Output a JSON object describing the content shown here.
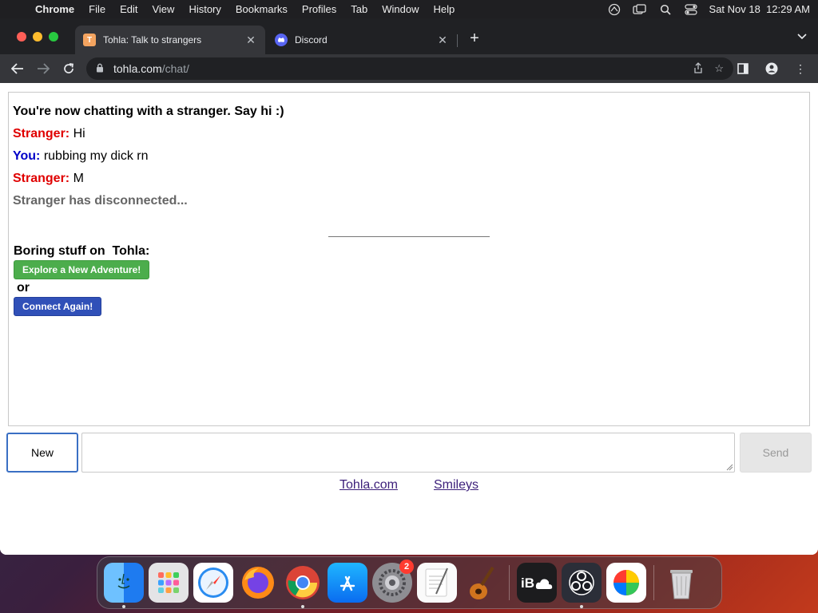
{
  "menubar": {
    "app": "Chrome",
    "items": [
      "File",
      "Edit",
      "View",
      "History",
      "Bookmarks",
      "Profiles",
      "Tab",
      "Window",
      "Help"
    ],
    "datetime": "Sat Nov 18  12:29 AM"
  },
  "browser": {
    "tabs": [
      {
        "title": "Tohla: Talk to strangers",
        "favicon": "T",
        "active": true
      },
      {
        "title": "Discord",
        "favicon": "discord-icon",
        "active": false
      }
    ],
    "url_host": "tohla.com",
    "url_path": "/chat/"
  },
  "chat": {
    "intro": "You're now chatting with a stranger. Say hi :)",
    "messages": [
      {
        "speaker": "Stranger:",
        "text": "Hi",
        "type": "stranger"
      },
      {
        "speaker": "You:",
        "text": "rubbing my dick rn",
        "type": "you"
      },
      {
        "speaker": "Stranger:",
        "text": "M",
        "type": "stranger"
      }
    ],
    "status": "Stranger has disconnected...",
    "boring": "Boring stuff on  Tohla:",
    "explore_label": "Explore a New Adventure!",
    "or_text": "or",
    "connect_label": "Connect Again!"
  },
  "controls": {
    "new_label": "New",
    "send_label": "Send",
    "input_value": ""
  },
  "footer": {
    "links": [
      "Tohla.com",
      "Smileys"
    ]
  },
  "dock": {
    "apps": [
      "finder",
      "launchpad",
      "safari",
      "firefox",
      "chrome",
      "app-store",
      "system-preferences",
      "textedit",
      "garageband",
      "icloud",
      "obs",
      "color-app",
      "trash"
    ],
    "system_preferences_badge": "2"
  }
}
